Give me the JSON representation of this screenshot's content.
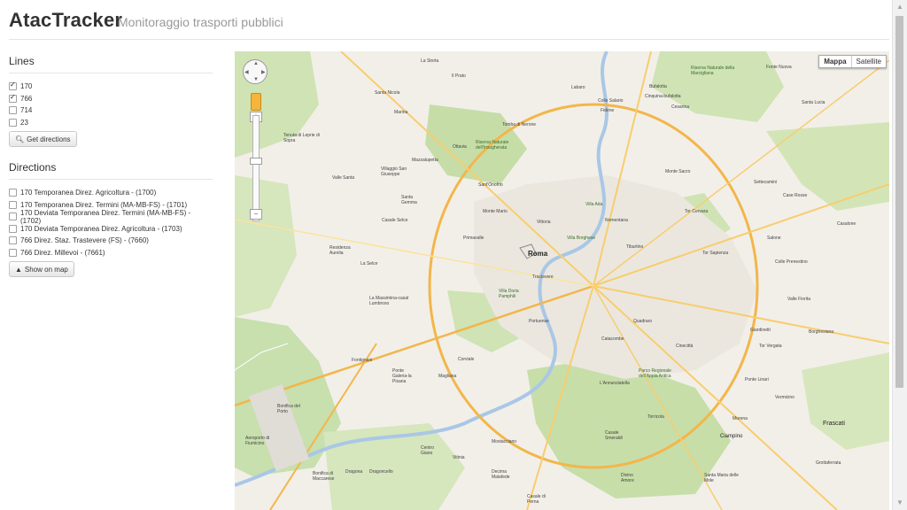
{
  "app": {
    "title": "AtacTracker",
    "subtitle": "Monitoraggio trasporti pubblici"
  },
  "lines": {
    "title": "Lines",
    "items": [
      {
        "label": "170",
        "checked": true
      },
      {
        "label": "766",
        "checked": true
      },
      {
        "label": "714",
        "checked": false
      },
      {
        "label": "23",
        "checked": false
      }
    ],
    "button_label": "Get directions"
  },
  "directions": {
    "title": "Directions",
    "items": [
      {
        "label": "170 Temporanea Direz. Agricoltura - (1700)",
        "checked": false
      },
      {
        "label": "170 Temporanea Direz. Termini (MA-MB-FS) - (1701)",
        "checked": false
      },
      {
        "label": "170 Deviata Temporanea Direz. Termini (MA-MB-FS) - (1702)",
        "checked": false
      },
      {
        "label": "170 Deviata Temporanea Direz. Agricoltura - (1703)",
        "checked": false
      },
      {
        "label": "766 Direz. Staz. Trastevere (FS) - (7660)",
        "checked": false
      },
      {
        "label": "766 Direz. Millevoi - (7661)",
        "checked": false
      }
    ],
    "button_label": "Show on map"
  },
  "map": {
    "map_type_active": "Mappa",
    "map_type_other": "Satellite",
    "city_label": "Roma",
    "labels": {
      "la_storta": "La Storta",
      "il_prato": "Il Prato",
      "santa_nicola": "Santa Nicola",
      "marina": "Marina",
      "tenuta": "Tenuta di Leprie di Sopra",
      "labaro": "Labaro",
      "bufalotta": "Bufalotta",
      "cinquina": "Cinquina-bufalotta",
      "cesarina": "Cesarina",
      "colle_salario": "Colle Salario",
      "fidene": "Fidene",
      "riserva_marcigliana": "Riserva Naturale della Marcigliana",
      "fonte_nuova": "Fonte Nuova",
      "santa_lucia": "Santa Lucia",
      "tomba_nerone": "Tomba di Nerone",
      "ottavia": "Ottavia",
      "mazzalupetta": "Mazzalupetta",
      "insugherata": "Riserva Naturale dell'Insugherata",
      "monte_mario": "Monte Mario",
      "sant_onofrio": "Sant'Onofrio",
      "villaggio_giuseppe": "Villaggio San Giuseppe",
      "valle_santa": "Valle Santa",
      "santa_gemma": "Santa Gemma",
      "casale_selce": "Casale Selce",
      "residenza_aurelia": "Residenza Aurelia",
      "la_selce": "La Selce",
      "primavalle": "Primavalle",
      "villa_ada": "Villa Ada",
      "monte_sacro": "Monte Sacro",
      "nomentana": "Nomentana",
      "tor_cervara": "Tor Cervara",
      "settecamini": "Settecamini",
      "case_rosse": "Case Rosse",
      "vittoria": "Vittoria",
      "villa_borghese": "Villa Borghese",
      "tiburtino": "Tiburtino",
      "tor_sapienza": "Tor Sapienza",
      "salone": "Salone",
      "casalone": "Casalone",
      "trastevere": "Trastevere",
      "villa_doria": "Villa Doria Pamphili",
      "massimina": "La Massimina-casal Lumbroso",
      "colle_prenestino": "Colle Prenestino",
      "valle_fiorita": "Valle Fiorita",
      "quadraro": "Quadraro",
      "portuense": "Portuense",
      "catacombe": "Catacombe",
      "giardinetti": "Giardinetti",
      "borghesiana": "Borghesiana",
      "tor_vergata": "Tor Vergata",
      "cinecitta": "Cinecittà",
      "fontignani": "Fontignani",
      "corviale": "Corviale",
      "ponte_galeria": "Ponte Galeria-la Pisana",
      "magliana": "Magliana",
      "annunziatella": "L'Annunziatella",
      "appia_antica": "Parco Regionale dell'Appia Antica",
      "torricola": "Torricola",
      "vermicino": "Vermicino",
      "ponte_linari": "Ponte Linari",
      "frascati": "Frascati",
      "morena": "Morena",
      "ciampino": "Ciampino",
      "grottaferrata": "Grottaferrata",
      "bonifica_porto": "Bonifica del Porto",
      "fiumicino": "Aeroporto di Fiumicino",
      "mostacciano": "Mostacciano",
      "centro_giano": "Centro Giano",
      "decima": "Decima Malafede",
      "vitinia": "Vitinia",
      "casale_perna": "Casale di Perna",
      "divino_amore": "Divino Amore",
      "casale_smeraldi": "Casale Smeraldi",
      "bonifica_maccarese": "Bonifica di Maccarese",
      "dragona": "Dragona",
      "dragoncello": "Dragoncello",
      "santa_maria_delle_mole": "Santa Maria delle Mole"
    }
  }
}
